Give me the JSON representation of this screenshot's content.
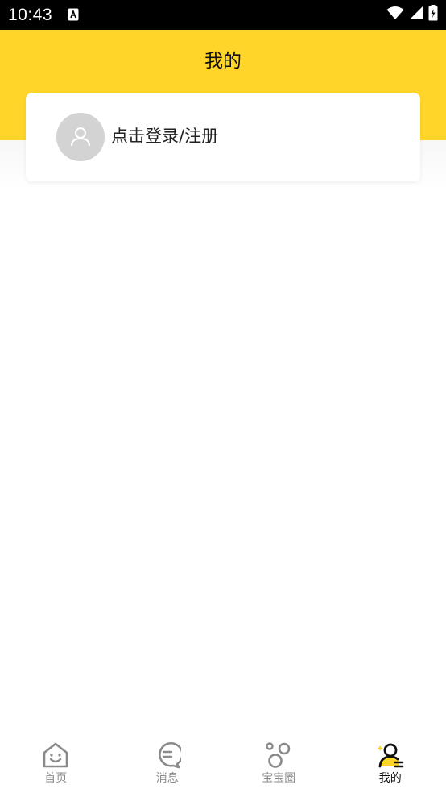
{
  "status_bar": {
    "time": "10:43",
    "icons": [
      "a-notification-icon",
      "wifi-icon",
      "signal-icon",
      "battery-charging-icon"
    ]
  },
  "header": {
    "title": "我的"
  },
  "login_card": {
    "label": "点击登录/注册",
    "avatar_icon": "user-placeholder-icon"
  },
  "bottom_nav": {
    "items": [
      {
        "label": "首页",
        "icon": "home-icon",
        "active": false
      },
      {
        "label": "消息",
        "icon": "message-icon",
        "active": false
      },
      {
        "label": "宝宝圈",
        "icon": "baby-circle-icon",
        "active": false
      },
      {
        "label": "我的",
        "icon": "profile-icon",
        "active": true
      }
    ]
  },
  "colors": {
    "accent": "#FFD52A",
    "inactive_label": "#8A8A8A",
    "active_label": "#111111",
    "status_bar": "#000000"
  }
}
